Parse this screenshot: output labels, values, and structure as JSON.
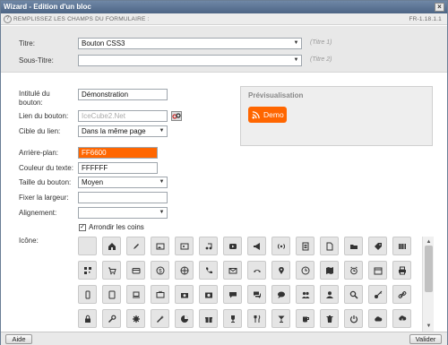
{
  "window": {
    "title": "Wizard - Edition d'un bloc",
    "close": "×"
  },
  "infobar": {
    "text": "REMPLISSEZ LES CHAMPS DU FORMULAIRE :",
    "version": "FR-1.18.1.1"
  },
  "header": {
    "titre": {
      "label": "Titre:",
      "value": "Bouton CSS3",
      "hint": "(Titre 1)"
    },
    "sous_titre": {
      "label": "Sous-Titre:",
      "value": "",
      "hint": "(Titre 2)"
    }
  },
  "form": {
    "intitule": {
      "label": "Intitulé du bouton:",
      "value": "Démonstration"
    },
    "lien": {
      "label": "Lien du bouton:",
      "placeholder": "IceCube2.Net"
    },
    "cible": {
      "label": "Cible du lien:",
      "value": "Dans la même page"
    },
    "arriere_plan": {
      "label": "Arrière-plan:",
      "value": "FF6600",
      "color": "#ff6600"
    },
    "couleur_texte": {
      "label": "Couleur du texte:",
      "value": "FFFFFF"
    },
    "taille": {
      "label": "Taille du bouton:",
      "value": "Moyen"
    },
    "largeur": {
      "label": "Fixer la largeur:",
      "value": ""
    },
    "alignement": {
      "label": "Alignement:",
      "value": ""
    },
    "arrondir": {
      "label": "Arrondir les coins",
      "checked": true
    },
    "icone": {
      "label": "Icône:"
    }
  },
  "preview": {
    "title": "Prévisualisation",
    "button_label": "Demo",
    "button_color": "#ff6600",
    "button_icon": "rss-icon"
  },
  "icons": [
    [
      "none",
      "home-icon",
      "pencil-icon",
      "image-icon",
      "picture-icon",
      "music-icon",
      "play-icon",
      "megaphone-icon",
      "broadcast-icon",
      "document-icon",
      "file-icon",
      "folder-icon",
      "tag-icon",
      "barcode-icon"
    ],
    [
      "qrcode-icon",
      "cart-icon",
      "credit-card-icon",
      "dollar-icon",
      "globe-icon",
      "phone-icon",
      "mail-icon",
      "hangup-icon",
      "pin-icon",
      "clock-icon",
      "map-icon",
      "alarm-icon",
      "calendar-icon",
      "printer-icon"
    ],
    [
      "mobile-icon",
      "tablet-icon",
      "laptop-icon",
      "tv-icon",
      "camera-icon",
      "photo-icon",
      "comment-icon",
      "comments-icon",
      "chat-icon",
      "users-icon",
      "user-icon",
      "search-icon",
      "key-icon",
      "link-icon"
    ],
    [
      "lock-icon",
      "wrench-icon",
      "gear-icon",
      "magic-icon",
      "pie-chart-icon",
      "gift-icon",
      "trophy-icon",
      "cutlery-icon",
      "glass-icon",
      "cup-icon",
      "trash-icon",
      "power-icon",
      "cloud-icon",
      "cloud-download-icon"
    ]
  ],
  "footer": {
    "aide": "Aide",
    "valider": "Valider"
  }
}
